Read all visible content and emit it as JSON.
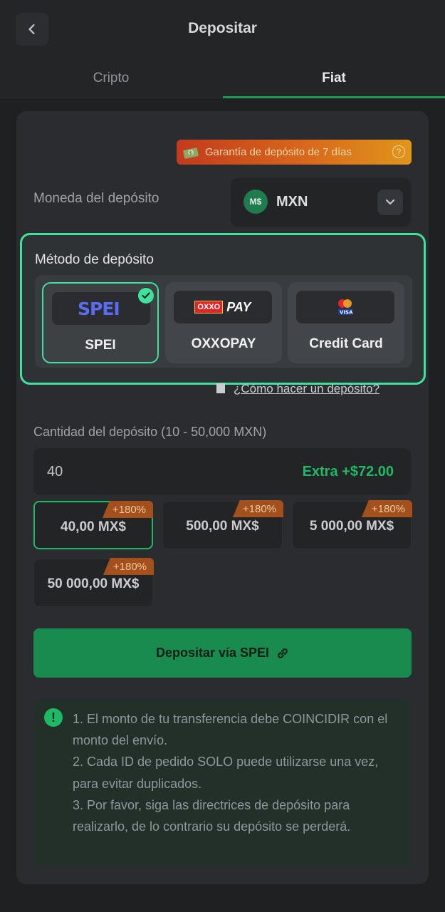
{
  "header": {
    "title": "Depositar"
  },
  "tabs": [
    {
      "label": "Cripto",
      "active": false
    },
    {
      "label": "Fiat",
      "active": true
    }
  ],
  "guarantee": {
    "text": "Garantía de depósito de 7 días",
    "help": "?"
  },
  "currency": {
    "label": "Moneda del depósito",
    "coin": "M$",
    "code": "MXN"
  },
  "method": {
    "title": "Método de depósito",
    "options": [
      {
        "label": "SPEI",
        "logo": "SPEI",
        "selected": true
      },
      {
        "label": "OXXOPAY",
        "logo_left": "OXXO",
        "logo_right": "PAY",
        "selected": false
      },
      {
        "label": "Credit Card",
        "logo": "VISA",
        "selected": false
      }
    ]
  },
  "howto": "¿Cómo hacer un depósito?",
  "amount": {
    "label": "Cantidad del depósito (10 - 50,000 MXN)",
    "value": "40",
    "extra": "Extra +$72.00",
    "presets": [
      {
        "value": "40,00 MX$",
        "badge": "+180%",
        "selected": true
      },
      {
        "value": "500,00 MX$",
        "badge": "+180%",
        "selected": false
      },
      {
        "value": "5 000,00 MX$",
        "badge": "+180%",
        "selected": false
      },
      {
        "value": "50 000,00 MX$",
        "badge": "+180%",
        "selected": false
      }
    ]
  },
  "deposit_button": "Depositar vía SPEI",
  "notice": {
    "lines": [
      "1. El monto de tu transferencia debe COINCIDIR con el monto del envío.",
      "2. Cada ID de pedido SOLO puede utilizarse una vez, para evitar duplicados.",
      "3. Por favor, siga las directrices de depósito para realizarlo, de lo contrario su depósito se perderá."
    ]
  },
  "colors": {
    "accent": "#3fe29a",
    "primary_green": "#1a8b4f",
    "extra_green": "#1fb865",
    "badge": "#a4501c",
    "background": "#1e2022"
  }
}
